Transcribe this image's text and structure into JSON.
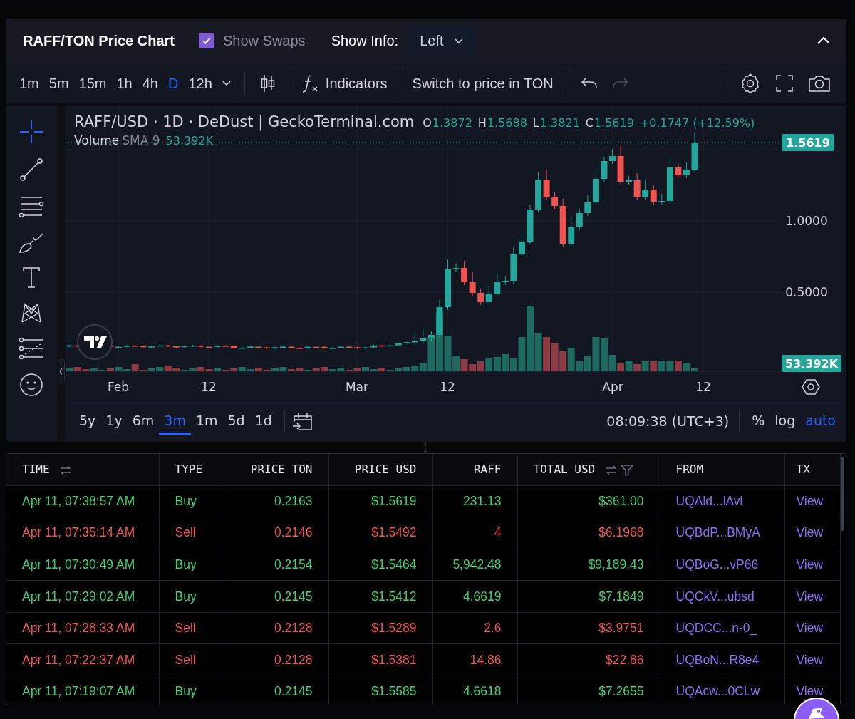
{
  "header": {
    "title": "RAFF/TON Price Chart",
    "show_swaps": {
      "label": "Show Swaps",
      "checked": true
    },
    "show_info": {
      "label": "Show Info:",
      "value": "Left"
    }
  },
  "toolbar": {
    "intervals": [
      {
        "label": "1m",
        "selected": false
      },
      {
        "label": "5m",
        "selected": false
      },
      {
        "label": "15m",
        "selected": false
      },
      {
        "label": "1h",
        "selected": false
      },
      {
        "label": "4h",
        "selected": false
      },
      {
        "label": "D",
        "selected": true
      },
      {
        "label": "12h",
        "selected": false
      }
    ],
    "indicators": "Indicators",
    "switch_price": "Switch to price in TON",
    "redo": {
      "disabled": true
    }
  },
  "chart": {
    "legend": {
      "symbol": "RAFF/USD · 1D · DeDust | GeckoTerminal.com",
      "ohlc": [
        {
          "key": "O",
          "value": "1.3872"
        },
        {
          "key": "H",
          "value": "1.5688"
        },
        {
          "key": "L",
          "value": "1.3821"
        },
        {
          "key": "C",
          "value": "1.5619"
        }
      ],
      "change": "+0.1747 (+12.59%)"
    },
    "volume_legend": {
      "name": "Volume",
      "ma": "SMA 9",
      "value": "53.392K"
    },
    "price_labels": [
      "1.0000",
      "0.5000"
    ],
    "last_price": "1.5619",
    "last_volume": "53.392K",
    "time_labels": [
      "Feb",
      "12",
      "Mar",
      "12",
      "Apr",
      "12"
    ]
  },
  "ranges": [
    {
      "label": "5y",
      "selected": false
    },
    {
      "label": "1y",
      "selected": false
    },
    {
      "label": "6m",
      "selected": false
    },
    {
      "label": "3m",
      "selected": true
    },
    {
      "label": "1m",
      "selected": false
    },
    {
      "label": "5d",
      "selected": false
    },
    {
      "label": "1d",
      "selected": false
    }
  ],
  "clock": "08:09:38 (UTC+3)",
  "scale_options": [
    {
      "label": "%",
      "selected": false
    },
    {
      "label": "log",
      "selected": false
    },
    {
      "label": "auto",
      "selected": true
    }
  ],
  "table": {
    "columns": [
      {
        "label": "TIME",
        "sortable": true,
        "filterable": false
      },
      {
        "label": "TYPE",
        "sortable": false,
        "filterable": false
      },
      {
        "label": "PRICE TON",
        "sortable": false,
        "filterable": false
      },
      {
        "label": "PRICE USD",
        "sortable": false,
        "filterable": false
      },
      {
        "label": "RAFF",
        "sortable": false,
        "filterable": false
      },
      {
        "label": "TOTAL USD",
        "sortable": true,
        "filterable": true
      },
      {
        "label": "FROM",
        "sortable": false,
        "filterable": false
      },
      {
        "label": "TX",
        "sortable": false,
        "filterable": false
      }
    ],
    "rows": [
      {
        "kind": "buy",
        "time": "Apr 11, 07:38:57 AM",
        "type": "Buy",
        "price_ton": "0.2163",
        "price_usd": "$1.5619",
        "amount": "231.13",
        "total_usd": "$361.00",
        "from": "UQAld...lAvl",
        "tx": "View"
      },
      {
        "kind": "sell",
        "time": "Apr 11, 07:35:14 AM",
        "type": "Sell",
        "price_ton": "0.2146",
        "price_usd": "$1.5492",
        "amount": "4",
        "total_usd": "$6.1968",
        "from": "UQBdP...BMyA",
        "tx": "View"
      },
      {
        "kind": "buy",
        "time": "Apr 11, 07:30:49 AM",
        "type": "Buy",
        "price_ton": "0.2154",
        "price_usd": "$1.5464",
        "amount": "5,942.48",
        "total_usd": "$9,189.43",
        "from": "UQBoG...vP66",
        "tx": "View"
      },
      {
        "kind": "buy",
        "time": "Apr 11, 07:29:02 AM",
        "type": "Buy",
        "price_ton": "0.2145",
        "price_usd": "$1.5412",
        "amount": "4.6619",
        "total_usd": "$7.1849",
        "from": "UQCkV...ubsd",
        "tx": "View"
      },
      {
        "kind": "sell",
        "time": "Apr 11, 07:28:33 AM",
        "type": "Sell",
        "price_ton": "0.2128",
        "price_usd": "$1.5289",
        "amount": "2.6",
        "total_usd": "$3.9751",
        "from": "UQDCC...n-0_",
        "tx": "View"
      },
      {
        "kind": "sell",
        "time": "Apr 11, 07:22:37 AM",
        "type": "Sell",
        "price_ton": "0.2128",
        "price_usd": "$1.5381",
        "amount": "14.86",
        "total_usd": "$22.86",
        "from": "UQBoN...R8e4",
        "tx": "View"
      },
      {
        "kind": "buy",
        "time": "Apr 11, 07:19:07 AM",
        "type": "Buy",
        "price_ton": "0.2145",
        "price_usd": "$1.5585",
        "amount": "4.6618",
        "total_usd": "$7.2655",
        "from": "UQAcw...0CLw",
        "tx": "View"
      }
    ]
  }
}
